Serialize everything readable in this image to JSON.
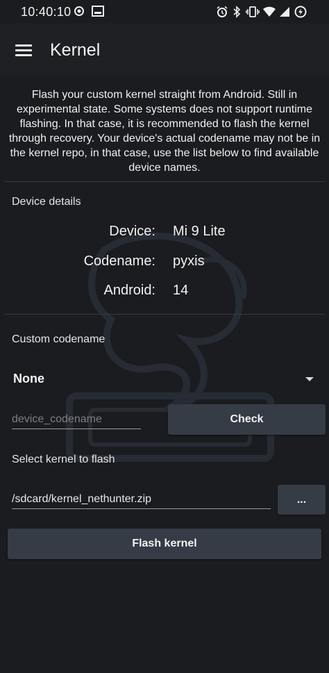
{
  "status_bar": {
    "time": "10:40:10",
    "icons": [
      "record-icon",
      "screenshot-icon",
      "alarm-icon",
      "bluetooth-icon",
      "vibrate-icon",
      "wifi-icon",
      "signal-icon",
      "battery-icon"
    ]
  },
  "app_bar": {
    "title": "Kernel",
    "menu_icon": "menu-icon"
  },
  "intro_text": "Flash your custom kernel straight from Android. Still in experimental state. Some systems does not support runtime flashing. In that case, it is recommended to flash the kernel through recovery. Your device's actual codename may not be in the kernel repo, in that case, use the list below to find available device names.",
  "device_details": {
    "label": "Device details",
    "rows": [
      {
        "key": "Device:",
        "value": "Mi 9 Lite"
      },
      {
        "key": "Codename:",
        "value": "pyxis"
      },
      {
        "key": "Android:",
        "value": "14"
      }
    ]
  },
  "custom_codename": {
    "label": "Custom codename",
    "selected": "None",
    "input_placeholder": "device_codename",
    "check_button": "Check"
  },
  "select_kernel": {
    "label": "Select kernel to flash",
    "path_value": "/sdcard/kernel_nethunter.zip",
    "browse_button": "...",
    "flash_button": "Flash kernel"
  }
}
